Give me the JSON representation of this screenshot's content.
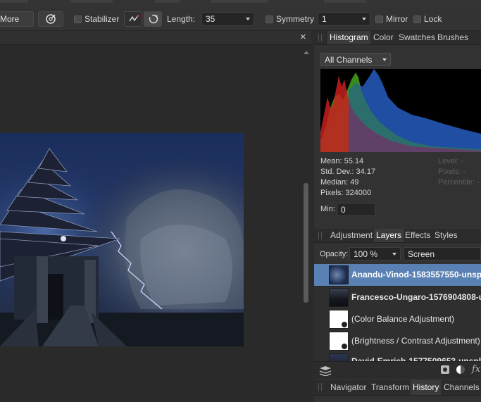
{
  "toolbar": {
    "more_label": "More",
    "stabilizer_label": "Stabilizer",
    "length_label": "Length:",
    "length_value": "35",
    "symmetry_label": "Symmetry",
    "symmetry_value": "1",
    "mirror_label": "Mirror",
    "lock_label": "Lock"
  },
  "document": {
    "close_glyph": "×"
  },
  "histogram_panel": {
    "tabs": [
      "Histogram",
      "Color",
      "Swatches",
      "Brushes"
    ],
    "active_tab": "Histogram",
    "channel_select": "All Channels",
    "stats": {
      "mean": "Mean: 55.14",
      "std_dev": "Std. Dev.: 34.17",
      "median": "Median: 49",
      "pixels": "Pixels: 324000"
    },
    "right_stats": {
      "level": "Level: -",
      "pixels": "Pixels: -",
      "percentile": "Percentile: -"
    },
    "min_label": "Min:",
    "min_value": "0",
    "colors": {
      "red": "#c81f1f",
      "green": "#3e9b1e",
      "blue": "#1f4fa3",
      "background": "#000000"
    }
  },
  "layers_panel": {
    "tabs": [
      "Adjustment",
      "Layers",
      "Effects",
      "Styles"
    ],
    "active_tab": "Layers",
    "opacity_label": "Opacity:",
    "opacity_value": "100 %",
    "blend_mode": "Screen",
    "layers": [
      {
        "name": "Anandu-Vinod-1583557550-unsp",
        "bold": true,
        "selected": true,
        "thumb": "night-sky"
      },
      {
        "name": "Francesco-Ungaro-1576904808-u",
        "bold": true,
        "selected": false,
        "thumb": "dark-sea"
      },
      {
        "name": "(Color Balance Adjustment)",
        "bold": false,
        "selected": false,
        "thumb": "adjustment"
      },
      {
        "name": "(Brightness / Contrast Adjustment)",
        "bold": false,
        "selected": false,
        "thumb": "adjustment"
      },
      {
        "name": "David-Emrich-1577509653-unspl",
        "bold": true,
        "selected": false,
        "thumb": "pagoda"
      }
    ],
    "fx_label": "fx"
  },
  "navigator_panel": {
    "tabs": [
      "Navigator",
      "Transform",
      "History",
      "Channels"
    ],
    "active_tab": "History"
  }
}
